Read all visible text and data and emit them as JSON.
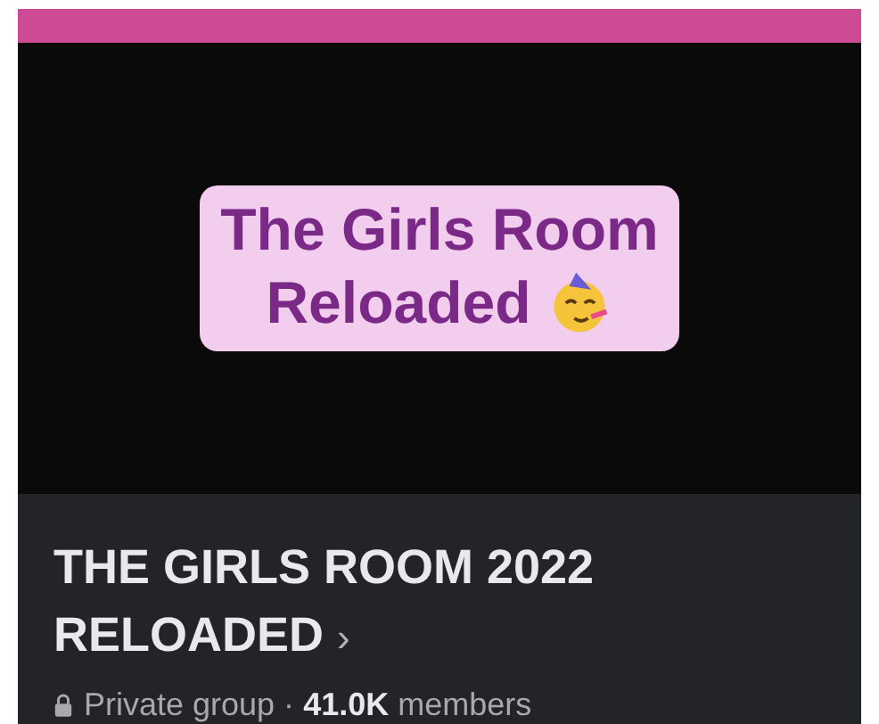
{
  "cover": {
    "caption_lines": [
      "The Girls Room",
      "Reloaded"
    ]
  },
  "group": {
    "title": "THE GIRLS ROOM 2022 RELOADED",
    "title_chevron": "›",
    "privacy": "Private group · **41.0K** members"
  }
}
